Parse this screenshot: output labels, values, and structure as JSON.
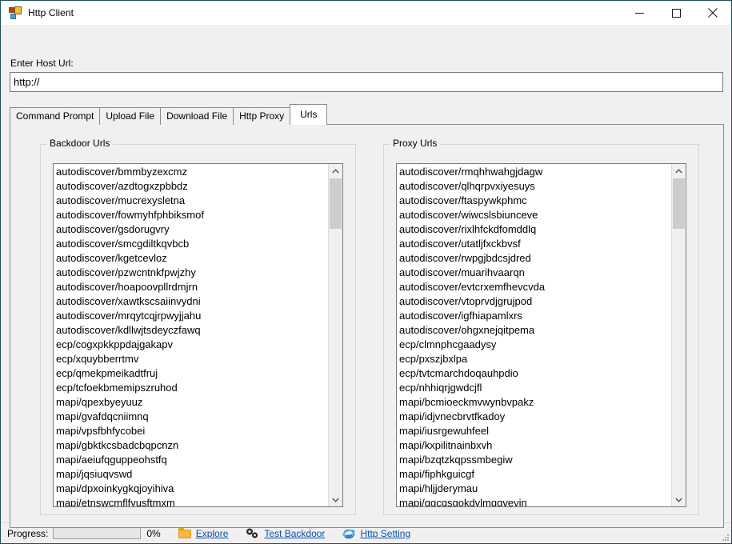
{
  "window": {
    "title": "Http Client",
    "icon": "app-icon",
    "controls": {
      "minimize": "minimize-icon",
      "maximize": "maximize-icon",
      "close": "close-icon"
    }
  },
  "host": {
    "label": "Enter Host Url:",
    "value": "http://",
    "placeholder": ""
  },
  "tabs": [
    {
      "label": "Command Prompt",
      "active": false
    },
    {
      "label": "Upload File",
      "active": false
    },
    {
      "label": "Download File",
      "active": false
    },
    {
      "label": "Http Proxy",
      "active": false
    },
    {
      "label": "Urls",
      "active": true
    }
  ],
  "backdoor_group": {
    "title": "Backdoor Urls",
    "items": [
      "autodiscover/bmmbyzexcmz",
      "autodiscover/azdtogxzpbbdz",
      "autodiscover/mucrexysletna",
      "autodiscover/fowmyhfphbiksmof",
      "autodiscover/gsdorugvry",
      "autodiscover/smcgdiltkqvbcb",
      "autodiscover/kgetcevloz",
      "autodiscover/pzwcntnkfpwjzhy",
      "autodiscover/hoapoovpllrdmjrn",
      "autodiscover/xawtkscsaiinvydni",
      "autodiscover/mrqytcqjrpwyjjahu",
      "autodiscover/kdllwjtsdeyczfawq",
      "ecp/cogxpkkppdajgakapv",
      "ecp/xquybberrtmv",
      "ecp/qmekpmeikadtfruj",
      "ecp/tcfoekbmemipszruhod",
      "mapi/qpexbyeyuuz",
      "mapi/gvafdqcniimnq",
      "mapi/vpsfbhfycobei",
      "mapi/gbktkcsbadcbqpcnzn",
      "mapi/aeiufqguppeohstfq",
      "mapi/jqsiuqvswd",
      "mapi/dpxoinkygkqjoyihiva",
      "mapi/etnswcmflfyusftmxm"
    ]
  },
  "proxy_group": {
    "title": "Proxy Urls",
    "items": [
      "autodiscover/rmqhhwahgjdagw",
      "autodiscover/qlhqrpvxiyesuys",
      "autodiscover/ftaspywkphmc",
      "autodiscover/wiwcslsbiunceve",
      "autodiscover/rixlhfckdfomddlq",
      "autodiscover/utatljfxckbvsf",
      "autodiscover/rwpgjbdcsjdred",
      "autodiscover/muarihvaarqn",
      "autodiscover/evtcrxemfhevcvda",
      "autodiscover/vtoprvdjgrujpod",
      "autodiscover/igfhiapamlxrs",
      "autodiscover/ohgxnejqitpema",
      "ecp/clmnphcgaadysy",
      "ecp/pxszjbxlpa",
      "ecp/tvtcmarchdoqauhpdio",
      "ecp/nhhiqrjgwdcjfl",
      "mapi/bcmioeckmvwynbvpakz",
      "mapi/idjvnecbrvtfkadoy",
      "mapi/iusrgewuhfeel",
      "mapi/kxpilitnainbxvh",
      "mapi/bzqtzkqpssmbegiw",
      "mapi/fiphkguicgf",
      "mapi/hljjderymau",
      "mapi/qgcqsgokdvlmggvevin"
    ]
  },
  "statusbar": {
    "progress_label": "Progress:",
    "progress_percent": "0%",
    "progress_value": 0,
    "explore_label": "Explore",
    "test_backdoor_label": "Test Backdoor",
    "http_setting_label": "Http Setting",
    "link_color": "#0b4fa8"
  }
}
